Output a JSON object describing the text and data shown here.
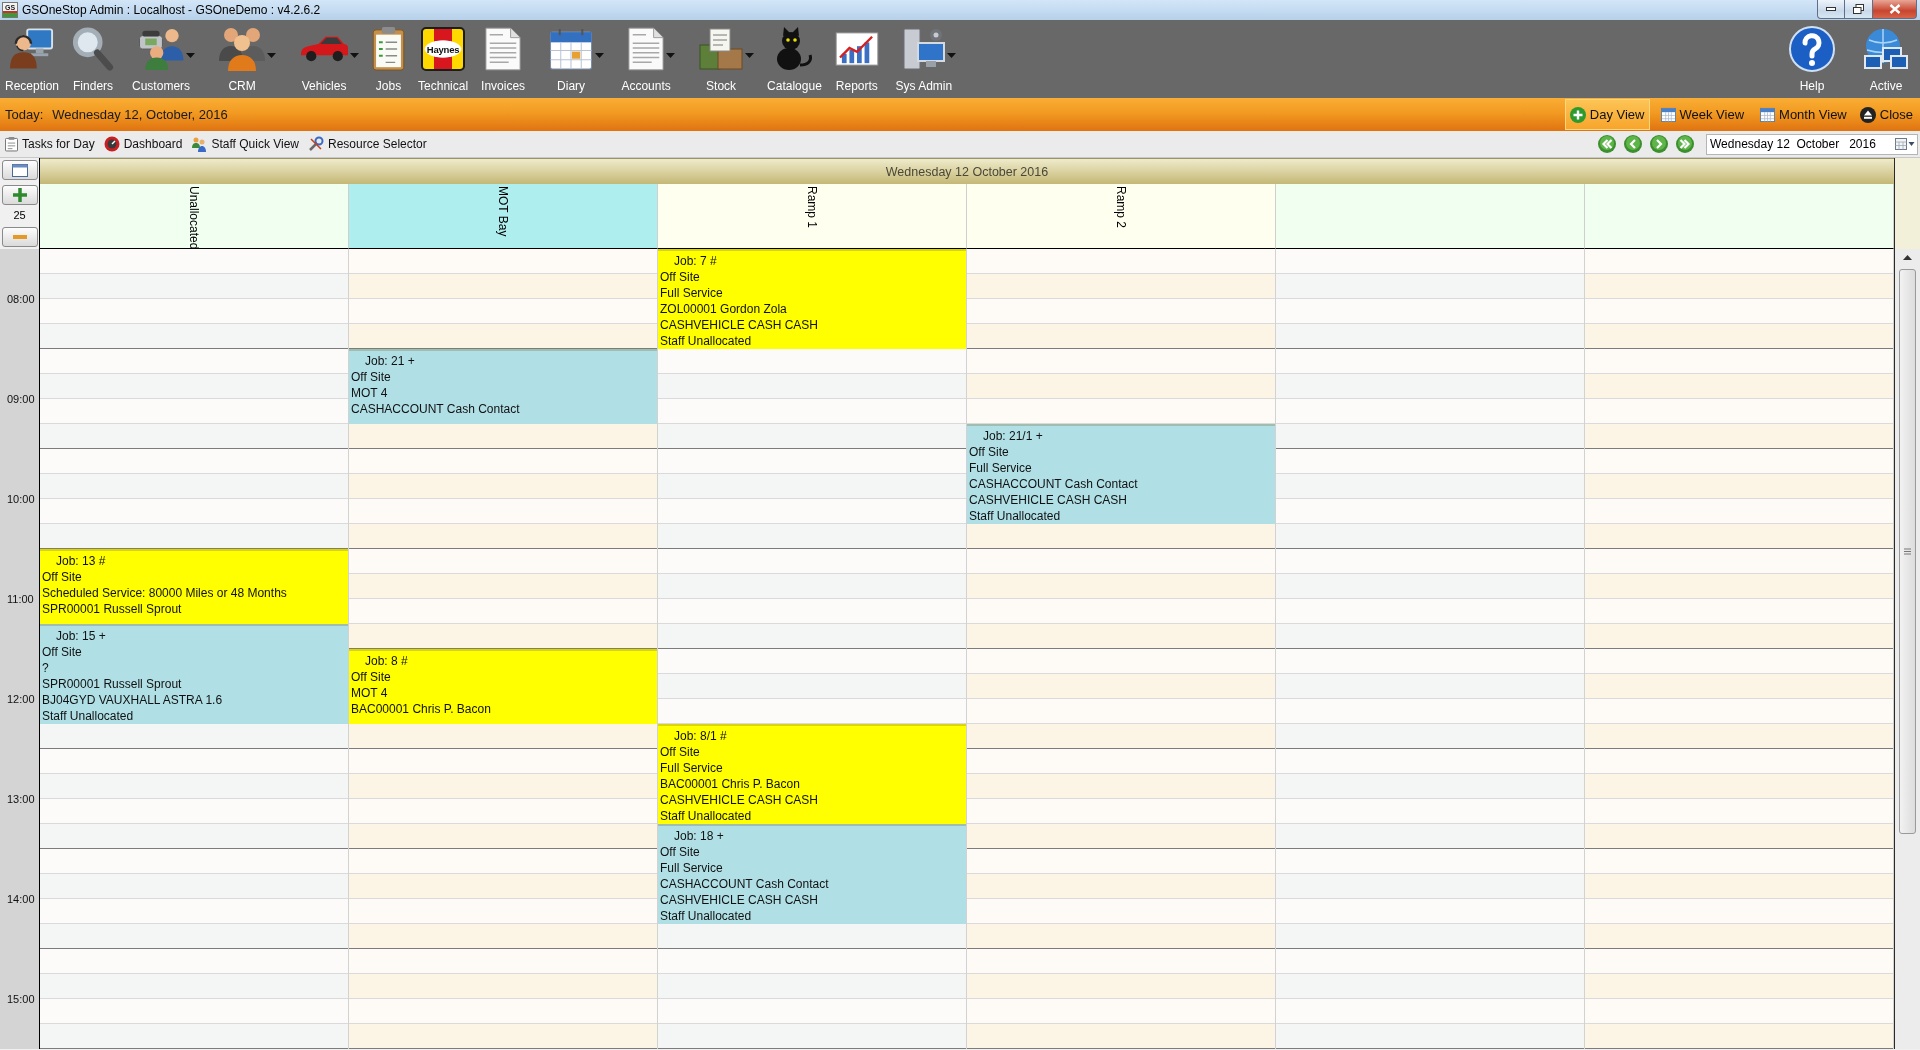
{
  "window": {
    "icon_text": "GS",
    "title": "GSOneStop Admin : Localhost - GSOneDemo : v4.2.6.2"
  },
  "toolbar": {
    "items": [
      {
        "label": "Reception",
        "kind": "reception",
        "has_menu": false
      },
      {
        "label": "Finders",
        "kind": "finders",
        "has_menu": false
      },
      {
        "label": "Customers",
        "kind": "customers",
        "has_menu": true
      },
      {
        "label": "CRM",
        "kind": "crm",
        "has_menu": true
      },
      {
        "label": "Vehicles",
        "kind": "vehicles",
        "has_menu": true
      },
      {
        "label": "Jobs",
        "kind": "jobs",
        "has_menu": false
      },
      {
        "label": "Technical",
        "kind": "technical",
        "has_menu": false,
        "logo_text": "Haynes"
      },
      {
        "label": "Invoices",
        "kind": "invoices",
        "has_menu": false
      },
      {
        "label": "Diary",
        "kind": "diary",
        "has_menu": true
      },
      {
        "label": "Accounts",
        "kind": "accounts",
        "has_menu": true
      },
      {
        "label": "Stock",
        "kind": "stock",
        "has_menu": true
      },
      {
        "label": "Catalogue",
        "kind": "catalogue",
        "has_menu": false
      },
      {
        "label": "Reports",
        "kind": "reports",
        "has_menu": false
      },
      {
        "label": "Sys Admin",
        "kind": "sysadmin",
        "has_menu": true
      }
    ],
    "right_items": [
      {
        "label": "Help",
        "kind": "help"
      },
      {
        "label": "Active",
        "kind": "active"
      }
    ]
  },
  "today_bar": {
    "label": "Today:",
    "date": "Wednesday 12, October, 2016",
    "views": [
      {
        "label": "Day View",
        "kind": "day",
        "selected": true
      },
      {
        "label": "Week View",
        "kind": "week",
        "selected": false
      },
      {
        "label": "Month View",
        "kind": "month",
        "selected": false
      }
    ],
    "close": "Close"
  },
  "action_bar": {
    "items": [
      {
        "label": "Tasks for Day",
        "kind": "tasks"
      },
      {
        "label": "Dashboard",
        "kind": "dashboard"
      },
      {
        "label": "Staff Quick View",
        "kind": "staff"
      },
      {
        "label": "Resource Selector",
        "kind": "resources"
      }
    ],
    "date_picker": {
      "value": "Wednesday 12  October   2016"
    }
  },
  "scheduler": {
    "date": "Wednesday 12 October 2016",
    "zoom_value": "25",
    "hours": [
      "08:00",
      "09:00",
      "10:00",
      "11:00",
      "12:00",
      "13:00",
      "14:00",
      "15:00"
    ],
    "resources": [
      {
        "name": "Unallocated",
        "color": "#f0fff0",
        "slots": [
          {
            "kind": "free"
          },
          {
            "kind": "free"
          },
          {
            "kind": "free"
          },
          {
            "kind": "free"
          },
          {
            "kind": "free"
          },
          {
            "kind": "free"
          },
          {
            "kind": "free"
          },
          {
            "kind": "free"
          },
          {
            "kind": "free"
          },
          {
            "kind": "free"
          },
          {
            "kind": "free"
          },
          {
            "kind": "free"
          },
          {
            "kind": "job",
            "title": "Job: 13 #",
            "lines": [
              "Off Site",
              "Scheduled Service: 80000 Miles or 48 Months",
              "SPR00001 Russell Sprout"
            ],
            "color": "#ffff00"
          },
          {
            "kind": "covered"
          },
          {
            "kind": "covered"
          },
          {
            "kind": "job",
            "title": "Job: 15 +",
            "lines": [
              "Off Site",
              "?",
              "SPR00001 Russell Sprout",
              "BJ04GYD VAUXHALL ASTRA 1.6",
              "Staff Unallocated"
            ],
            "color": "#b0e0e6"
          },
          {
            "kind": "covered"
          },
          {
            "kind": "covered"
          },
          {
            "kind": "covered"
          },
          {
            "kind": "free"
          },
          {
            "kind": "free"
          },
          {
            "kind": "free"
          },
          {
            "kind": "free"
          },
          {
            "kind": "free"
          },
          {
            "kind": "free"
          },
          {
            "kind": "free"
          },
          {
            "kind": "free"
          },
          {
            "kind": "free"
          },
          {
            "kind": "free"
          },
          {
            "kind": "free"
          },
          {
            "kind": "free"
          },
          {
            "kind": "free"
          }
        ]
      },
      {
        "name": "MOT Bay",
        "color": "#afeeee",
        "slots": [
          {
            "kind": "free"
          },
          {
            "kind": "free"
          },
          {
            "kind": "free"
          },
          {
            "kind": "free"
          },
          {
            "kind": "job",
            "title": "Job: 21 +",
            "lines": [
              "Off Site",
              "MOT 4",
              "CASHACCOUNT Cash Contact"
            ],
            "color": "#b0e0e6"
          },
          {
            "kind": "covered"
          },
          {
            "kind": "covered"
          },
          {
            "kind": "free"
          },
          {
            "kind": "free"
          },
          {
            "kind": "free"
          },
          {
            "kind": "free"
          },
          {
            "kind": "free"
          },
          {
            "kind": "free"
          },
          {
            "kind": "free"
          },
          {
            "kind": "free"
          },
          {
            "kind": "free"
          },
          {
            "kind": "job",
            "title": "Job: 8 #",
            "lines": [
              "Off Site",
              "MOT 4",
              "BAC00001 Chris P. Bacon"
            ],
            "color": "#ffff00"
          },
          {
            "kind": "covered"
          },
          {
            "kind": "covered"
          },
          {
            "kind": "free"
          },
          {
            "kind": "free"
          },
          {
            "kind": "free"
          },
          {
            "kind": "free"
          },
          {
            "kind": "free"
          },
          {
            "kind": "free"
          },
          {
            "kind": "free"
          },
          {
            "kind": "free"
          },
          {
            "kind": "free"
          },
          {
            "kind": "free"
          },
          {
            "kind": "free"
          },
          {
            "kind": "free"
          },
          {
            "kind": "free"
          }
        ]
      },
      {
        "name": "Ramp 1",
        "color": "#fffff0",
        "slots": [
          {
            "kind": "job",
            "title": "Job: 7 #",
            "lines": [
              "Off Site",
              "Full Service",
              "ZOL00001 Gordon Zola",
              "CASHVEHICLE CASH CASH",
              "Staff Unallocated"
            ],
            "color": "#ffff00"
          },
          {
            "kind": "covered"
          },
          {
            "kind": "covered"
          },
          {
            "kind": "covered"
          },
          {
            "kind": "free"
          },
          {
            "kind": "free"
          },
          {
            "kind": "free"
          },
          {
            "kind": "free"
          },
          {
            "kind": "free"
          },
          {
            "kind": "free"
          },
          {
            "kind": "free"
          },
          {
            "kind": "free"
          },
          {
            "kind": "free"
          },
          {
            "kind": "free"
          },
          {
            "kind": "free"
          },
          {
            "kind": "free"
          },
          {
            "kind": "free"
          },
          {
            "kind": "free"
          },
          {
            "kind": "free"
          },
          {
            "kind": "job",
            "title": "Job: 8/1 #",
            "lines": [
              "Off Site",
              "Full Service",
              "BAC00001 Chris P. Bacon",
              "CASHVEHICLE CASH CASH",
              "Staff Unallocated"
            ],
            "color": "#ffff00"
          },
          {
            "kind": "covered"
          },
          {
            "kind": "covered"
          },
          {
            "kind": "covered"
          },
          {
            "kind": "job",
            "title": "Job: 18 +",
            "lines": [
              "Off Site",
              "Full Service",
              "CASHACCOUNT Cash Contact",
              "CASHVEHICLE CASH CASH",
              "Staff Unallocated"
            ],
            "color": "#b0e0e6"
          },
          {
            "kind": "covered"
          },
          {
            "kind": "covered"
          },
          {
            "kind": "covered"
          },
          {
            "kind": "free"
          },
          {
            "kind": "free"
          },
          {
            "kind": "free"
          },
          {
            "kind": "free"
          },
          {
            "kind": "free"
          }
        ]
      },
      {
        "name": "Ramp 2",
        "color": "#fffff0",
        "slots": [
          {
            "kind": "free"
          },
          {
            "kind": "free"
          },
          {
            "kind": "free"
          },
          {
            "kind": "free"
          },
          {
            "kind": "free"
          },
          {
            "kind": "free"
          },
          {
            "kind": "free"
          },
          {
            "kind": "job",
            "title": "Job: 21/1 +",
            "lines": [
              "Off Site",
              "Full Service",
              "CASHACCOUNT Cash Contact",
              "CASHVEHICLE CASH CASH",
              "Staff Unallocated"
            ],
            "color": "#b0e0e6"
          },
          {
            "kind": "covered"
          },
          {
            "kind": "covered"
          },
          {
            "kind": "covered"
          },
          {
            "kind": "free"
          },
          {
            "kind": "free"
          },
          {
            "kind": "free"
          },
          {
            "kind": "free"
          },
          {
            "kind": "free"
          },
          {
            "kind": "free"
          },
          {
            "kind": "free"
          },
          {
            "kind": "free"
          },
          {
            "kind": "free"
          },
          {
            "kind": "free"
          },
          {
            "kind": "free"
          },
          {
            "kind": "free"
          },
          {
            "kind": "free"
          },
          {
            "kind": "free"
          },
          {
            "kind": "free"
          },
          {
            "kind": "free"
          },
          {
            "kind": "free"
          },
          {
            "kind": "free"
          },
          {
            "kind": "free"
          },
          {
            "kind": "free"
          },
          {
            "kind": "free"
          }
        ]
      },
      {
        "color": "#f0fff0",
        "slots": [
          {
            "kind": "free"
          },
          {
            "kind": "free"
          },
          {
            "kind": "free"
          },
          {
            "kind": "free"
          },
          {
            "kind": "free"
          },
          {
            "kind": "free"
          },
          {
            "kind": "free"
          },
          {
            "kind": "free"
          },
          {
            "kind": "free"
          },
          {
            "kind": "free"
          },
          {
            "kind": "free"
          },
          {
            "kind": "free"
          },
          {
            "kind": "free"
          },
          {
            "kind": "free"
          },
          {
            "kind": "free"
          },
          {
            "kind": "free"
          },
          {
            "kind": "free"
          },
          {
            "kind": "free"
          },
          {
            "kind": "free"
          },
          {
            "kind": "free"
          },
          {
            "kind": "free"
          },
          {
            "kind": "free"
          },
          {
            "kind": "free"
          },
          {
            "kind": "free"
          },
          {
            "kind": "free"
          },
          {
            "kind": "free"
          },
          {
            "kind": "free"
          },
          {
            "kind": "free"
          },
          {
            "kind": "free"
          },
          {
            "kind": "free"
          },
          {
            "kind": "free"
          },
          {
            "kind": "free"
          }
        ]
      },
      {
        "color": "#f0fff0",
        "slots": [
          {
            "kind": "free"
          },
          {
            "kind": "free"
          },
          {
            "kind": "free"
          },
          {
            "kind": "free"
          },
          {
            "kind": "free"
          },
          {
            "kind": "free"
          },
          {
            "kind": "free"
          },
          {
            "kind": "free"
          },
          {
            "kind": "free"
          },
          {
            "kind": "free"
          },
          {
            "kind": "free"
          },
          {
            "kind": "free"
          },
          {
            "kind": "free"
          },
          {
            "kind": "free"
          },
          {
            "kind": "free"
          },
          {
            "kind": "free"
          },
          {
            "kind": "free"
          },
          {
            "kind": "free"
          },
          {
            "kind": "free"
          },
          {
            "kind": "free"
          },
          {
            "kind": "free"
          },
          {
            "kind": "free"
          },
          {
            "kind": "free"
          },
          {
            "kind": "free"
          },
          {
            "kind": "free"
          },
          {
            "kind": "free"
          },
          {
            "kind": "free"
          },
          {
            "kind": "free"
          },
          {
            "kind": "free"
          },
          {
            "kind": "free"
          },
          {
            "kind": "free"
          },
          {
            "kind": "free"
          }
        ]
      }
    ]
  }
}
